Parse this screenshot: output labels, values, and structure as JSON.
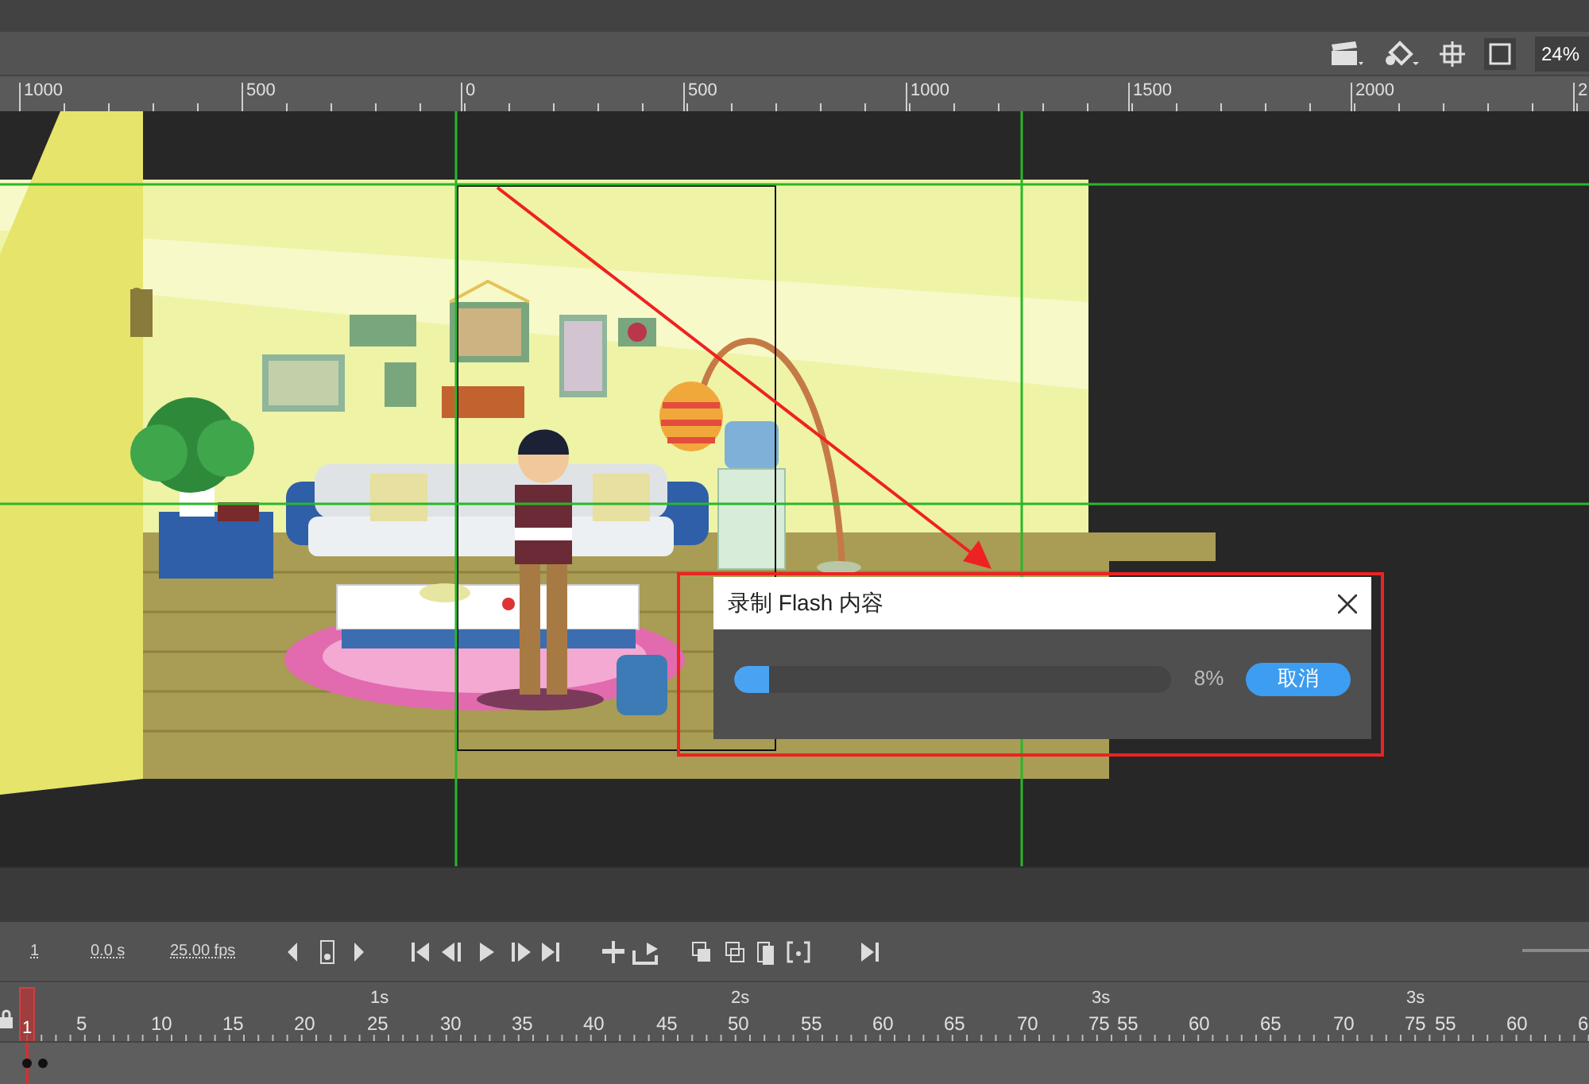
{
  "toolbar": {
    "zoom": "24%"
  },
  "ruler": {
    "labels": [
      "1000",
      "500",
      "0",
      "500",
      "1000",
      "1500",
      "2000",
      "2"
    ]
  },
  "dialog": {
    "title": "录制 Flash 内容",
    "progress": {
      "level": 0.08,
      "reading": "8%"
    },
    "cancel_button": "取消"
  },
  "timeline": {
    "current_frame": "1",
    "time": "0.0 s",
    "frame_rate": "25.00 fps",
    "playhead_frame": "1",
    "second_marks": [
      "1s",
      "2s",
      "3s",
      "3s"
    ],
    "frame_numbers": [
      "5",
      "10",
      "15",
      "20",
      "25",
      "30",
      "35",
      "40",
      "45",
      "50",
      "55",
      "60",
      "65",
      "70",
      "75",
      "55",
      "60",
      "65",
      "70",
      "75",
      "55",
      "60",
      "6"
    ]
  }
}
